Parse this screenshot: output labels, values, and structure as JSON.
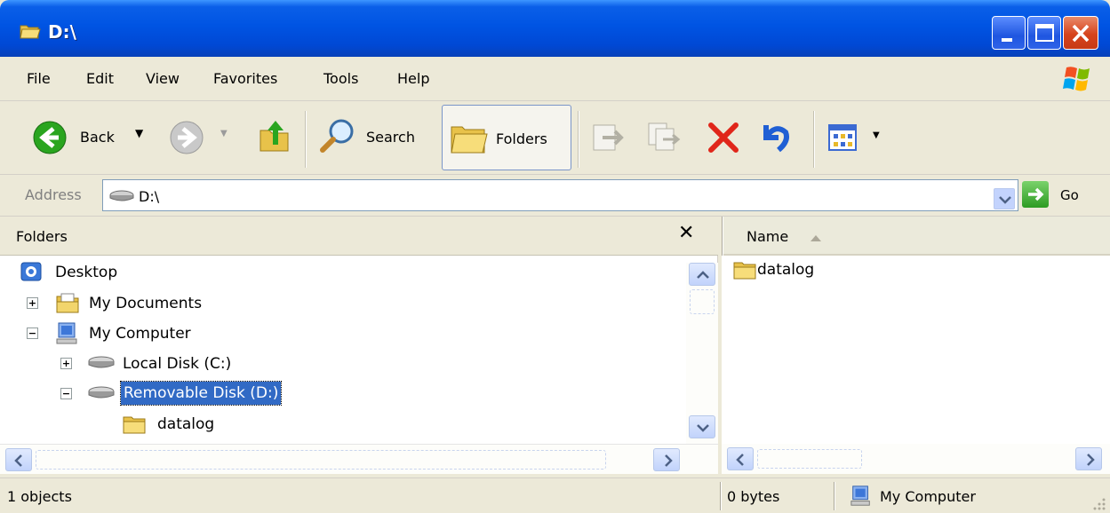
{
  "window": {
    "title": "D:\\"
  },
  "menu": [
    "File",
    "Edit",
    "View",
    "Favorites",
    "Tools",
    "Help"
  ],
  "toolbar": {
    "back_label": "Back",
    "search_label": "Search",
    "folders_label": "Folders"
  },
  "address": {
    "label": "Address",
    "value": "D:\\",
    "go_label": "Go"
  },
  "folders_pane": {
    "title": "Folders",
    "close_glyph": "✕",
    "tree": [
      {
        "label": "Desktop",
        "expander": ""
      },
      {
        "label": "My Documents",
        "expander": "+"
      },
      {
        "label": "My Computer",
        "expander": "−"
      },
      {
        "label": "Local Disk (C:)",
        "expander": "+"
      },
      {
        "label": "Removable Disk (D:)",
        "expander": "−",
        "selected": true
      },
      {
        "label": "datalog",
        "expander": ""
      }
    ]
  },
  "list_pane": {
    "column_name": "Name",
    "items": [
      {
        "name": "datalog"
      }
    ]
  },
  "status": {
    "objects": "1 objects",
    "size": "0 bytes",
    "zone": "My Computer"
  },
  "icons": {
    "title": "folder-open-icon",
    "back": "back-arrow-icon",
    "forward": "forward-arrow-icon",
    "up": "up-folder-icon",
    "search": "search-icon",
    "folders": "folders-icon",
    "move": "move-to-icon",
    "copy": "copy-to-icon",
    "delete": "delete-icon",
    "undo": "undo-icon",
    "views": "views-icon",
    "drive": "drive-icon",
    "go": "go-arrow-icon",
    "computer": "my-computer-icon"
  },
  "colors": {
    "titlebar": "#0054e3",
    "selection": "#316ac5",
    "delete": "#e0261a",
    "undo": "#1f5fd4",
    "back": "#2aa51f"
  }
}
